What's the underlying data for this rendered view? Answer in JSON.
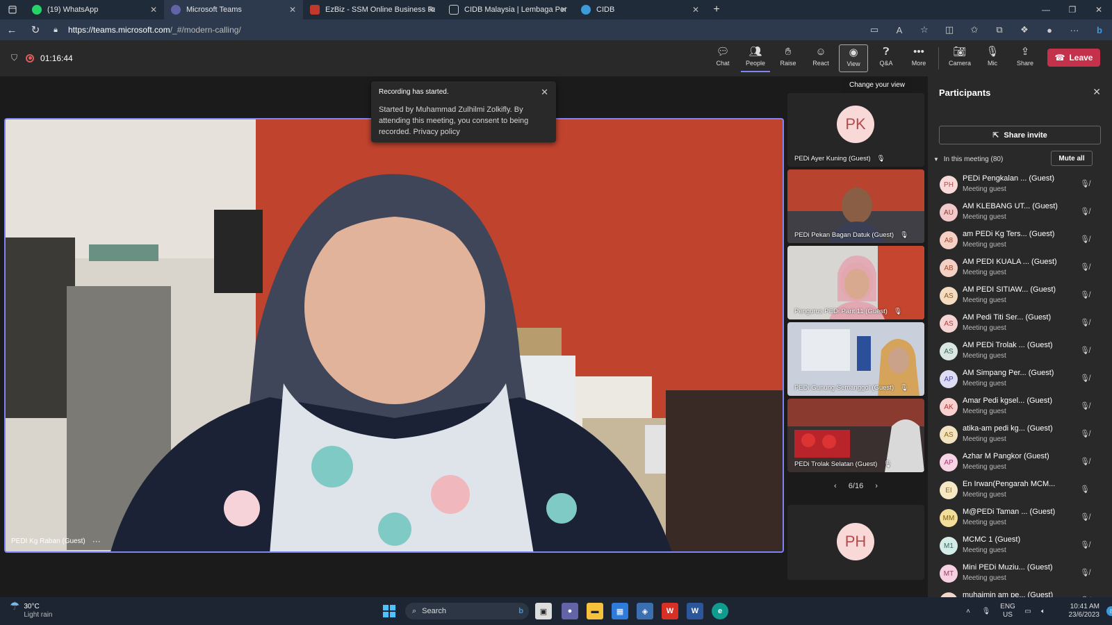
{
  "browser": {
    "tabs": [
      {
        "label": "(19) WhatsApp",
        "color": "#25d366"
      },
      {
        "label": "Microsoft Teams",
        "color": "#6264a7"
      },
      {
        "label": "EzBiz - SSM Online Business Reg",
        "color": "#c0392b"
      },
      {
        "label": "CIDB Malaysia | Lembaga Pemba",
        "color": "#cccccc"
      },
      {
        "label": "CIDB",
        "color": "#3c9ad8"
      }
    ],
    "url_host": "https://teams.microsoft.com",
    "url_path": "/_#/modern-calling/"
  },
  "meeting": {
    "timer": "01:16:44",
    "controls": [
      {
        "label": "Chat",
        "icon": "chat-icon"
      },
      {
        "label": "People",
        "icon": "people-icon"
      },
      {
        "label": "Raise",
        "icon": "hand-icon"
      },
      {
        "label": "React",
        "icon": "smile-icon"
      },
      {
        "label": "View",
        "icon": "view-icon"
      },
      {
        "label": "Q&A",
        "icon": "qna-icon"
      },
      {
        "label": "More",
        "icon": "more-icon"
      },
      {
        "label": "Camera",
        "icon": "camera-off-icon"
      },
      {
        "label": "Mic",
        "icon": "mic-off-icon"
      },
      {
        "label": "Share",
        "icon": "share-icon"
      }
    ],
    "leave_label": "Leave",
    "leave_color": "#c4314b",
    "view_tooltip": "Change your view"
  },
  "toast": {
    "title": "Recording has started.",
    "body": "Started by Muhammad Zulhilmi Zolkifly. By attending this meeting, you consent to being recorded. Privacy policy"
  },
  "main_video": {
    "name": "PEDI Kg Raban (Guest)",
    "menu": "···"
  },
  "tiles": [
    {
      "name": "PEDi Ayer Kuning (Guest)",
      "initials": "PK"
    },
    {
      "name": "PEDi Pekan Bagan Datuk (Guest)"
    },
    {
      "name": "Pengurus PEDi Parit 11 (Guest)"
    },
    {
      "name": "PEDi Gunung Semanggol (Guest)"
    },
    {
      "name": "PEDi Trolak Selatan (Guest)"
    }
  ],
  "pager": {
    "label": "6/16"
  },
  "extra_tile": {
    "initials": "PH"
  },
  "panel": {
    "title": "Participants",
    "share_invite": "Share invite",
    "in_meeting": "In this meeting (80)",
    "mute_all": "Mute all",
    "participants": [
      {
        "initials": "PH",
        "name": "PEDi Pengkalan ... (Guest)",
        "role": "Meeting guest",
        "bg": "#f9d8d8",
        "fg": "#b34b4b",
        "muted": true
      },
      {
        "initials": "AU",
        "name": "AM KLEBANG UT... (Guest)",
        "role": "Meeting guest",
        "bg": "#f2c9c9",
        "fg": "#8a3a3a",
        "muted": true
      },
      {
        "initials": "A8",
        "name": "am PEDi Kg Ters... (Guest)",
        "role": "Meeting guest",
        "bg": "#f6cfc5",
        "fg": "#a04c36",
        "muted": true
      },
      {
        "initials": "AB",
        "name": "AM PEDI KUALA ... (Guest)",
        "role": "Meeting guest",
        "bg": "#f4d0c4",
        "fg": "#9d4d33",
        "muted": true
      },
      {
        "initials": "AS",
        "name": "AM PEDI SITIAW... (Guest)",
        "role": "Meeting guest",
        "bg": "#f3dcc0",
        "fg": "#8c5a24",
        "muted": true
      },
      {
        "initials": "AS",
        "name": "AM Pedi Titi Ser... (Guest)",
        "role": "Meeting guest",
        "bg": "#f7d4d4",
        "fg": "#a84444",
        "muted": true
      },
      {
        "initials": "AS",
        "name": "AM PEDi Trolak ... (Guest)",
        "role": "Meeting guest",
        "bg": "#d9e6e1",
        "fg": "#3d6a5a",
        "muted": true
      },
      {
        "initials": "AP",
        "name": "AM Simpang Per... (Guest)",
        "role": "Meeting guest",
        "bg": "#dcdcf5",
        "fg": "#4a4a9c",
        "muted": true
      },
      {
        "initials": "AK",
        "name": "Amar Pedi kgsel... (Guest)",
        "role": "Meeting guest",
        "bg": "#f7d0cf",
        "fg": "#a3403c",
        "muted": true
      },
      {
        "initials": "AS",
        "name": "atika-am pedi kg... (Guest)",
        "role": "Meeting guest",
        "bg": "#f3e2bf",
        "fg": "#8a6a1f",
        "muted": true
      },
      {
        "initials": "AP",
        "name": "Azhar M Pangkor (Guest)",
        "role": "Meeting guest",
        "bg": "#f6d4e6",
        "fg": "#9c3f6e",
        "muted": true
      },
      {
        "initials": "EI",
        "name": "En Irwan(Pengarah MCM...",
        "role": "Meeting guest",
        "bg": "#f6e8c4",
        "fg": "#8b6d1f",
        "muted": false
      },
      {
        "initials": "MM",
        "name": "M@PEDi Taman ... (Guest)",
        "role": "Meeting guest",
        "bg": "#f2dd9a",
        "fg": "#7a5f0f",
        "muted": true
      },
      {
        "initials": "M1",
        "name": "MCMC 1 (Guest)",
        "role": "Meeting guest",
        "bg": "#d4ece8",
        "fg": "#2e6b61",
        "muted": true
      },
      {
        "initials": "MT",
        "name": "Mini PEDi Muziu... (Guest)",
        "role": "Meeting guest",
        "bg": "#f4d0e0",
        "fg": "#9a3d64",
        "muted": true
      },
      {
        "initials": "MA",
        "name": "muhaimin am pe... (Guest)",
        "role": "Meeting guest",
        "bg": "#f2d6c8",
        "fg": "#8f4c32",
        "muted": true
      }
    ]
  },
  "taskbar": {
    "temp": "30°C",
    "weather": "Light rain",
    "search": "Search",
    "lang1": "ENG",
    "lang2": "US",
    "time": "10:41 AM",
    "date": "23/6/2023",
    "notif": "8"
  }
}
